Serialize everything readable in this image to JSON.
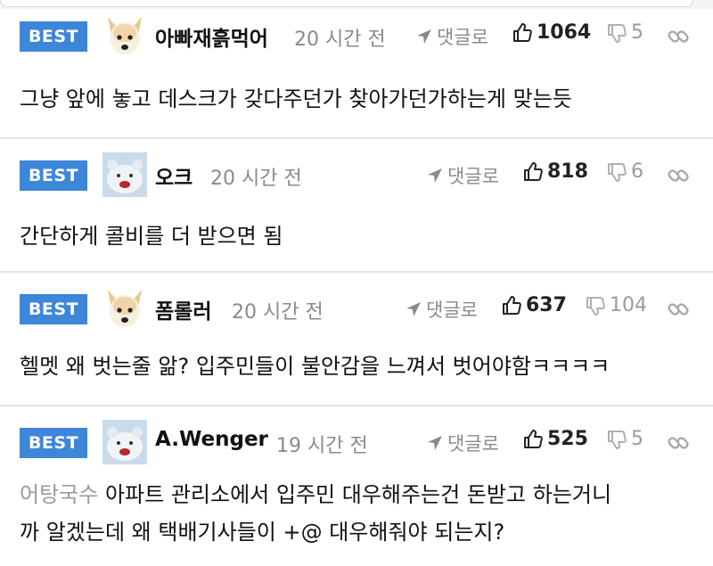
{
  "comments": [
    {
      "badge": "BEST",
      "nickname": "아빠재흙먹어",
      "time": "20 시간 전",
      "reply_label": "댓글로",
      "upvotes": "1064",
      "downvotes": "5",
      "avatar": "dog-face",
      "lines": [
        "그냥 앞에 놓고 데스크가 갖다주던가 찾아가던가하는게 맞는듯"
      ]
    },
    {
      "badge": "BEST",
      "nickname": "오크",
      "time": "20 시간 전",
      "reply_label": "댓글로",
      "upvotes": "818",
      "downvotes": "6",
      "avatar": "bear-face",
      "lines": [
        "간단하게 콜비를 더 받으면 됨"
      ]
    },
    {
      "badge": "BEST",
      "nickname": "폼롤러",
      "time": "20 시간 전",
      "reply_label": "댓글로",
      "upvotes": "637",
      "downvotes": "104",
      "avatar": "dog-face",
      "lines": [
        "헬멧 왜 벗는줄 앎? 입주민들이 불안감을 느껴서 벗어야함ㅋㅋㅋㅋ"
      ]
    },
    {
      "badge": "BEST",
      "nickname": "A.Wenger",
      "time": "19 시간 전",
      "reply_label": "댓글로",
      "upvotes": "525",
      "downvotes": "5",
      "avatar": "bear-face",
      "quoted_user": "어탕국수",
      "lines": [
        "아파트 관리소에서 입주민 대우해주는건 돈받고 하는거니",
        "까 알겠는데 왜 택배기사들이 +@ 대우해줘야 되는지?"
      ]
    }
  ],
  "colors": {
    "badge": "#3d86d8",
    "muted": "#8a8a8a",
    "divider": "#e3e3e3"
  }
}
